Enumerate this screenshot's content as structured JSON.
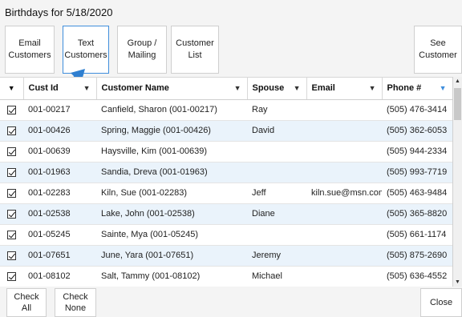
{
  "header": {
    "title": "Birthdays for 5/18/2020"
  },
  "toolbar": {
    "email": "Email\nCustomers",
    "text": "Text\nCustomers",
    "group": "Group /\nMailing",
    "list": "Customer\nList",
    "see": "See\nCustomer"
  },
  "grid": {
    "columns": [
      "Cust Id",
      "Customer Name",
      "Spouse",
      "Email",
      "Phone #"
    ],
    "rows": [
      {
        "id": "001-00217",
        "name": "Canfield, Sharon (001-00217)",
        "spouse": "Ray",
        "email": "",
        "phone": "(505) 476-3414"
      },
      {
        "id": "001-00426",
        "name": "Spring, Maggie (001-00426)",
        "spouse": "David",
        "email": "",
        "phone": "(505) 362-6053"
      },
      {
        "id": "001-00639",
        "name": "Haysville, Kim (001-00639)",
        "spouse": "",
        "email": "",
        "phone": "(505) 944-2334"
      },
      {
        "id": "001-01963",
        "name": "Sandia, Dreva (001-01963)",
        "spouse": "",
        "email": "",
        "phone": "(505) 993-7719"
      },
      {
        "id": "001-02283",
        "name": "Kiln, Sue (001-02283)",
        "spouse": "Jeff",
        "email": "kiln.sue@msn.com",
        "phone": "(505) 463-9484"
      },
      {
        "id": "001-02538",
        "name": "Lake, John (001-02538)",
        "spouse": "Diane",
        "email": "",
        "phone": "(505) 365-8820"
      },
      {
        "id": "001-05245",
        "name": "Sainte, Mya (001-05245)",
        "spouse": "",
        "email": "",
        "phone": "(505) 661-1174"
      },
      {
        "id": "001-07651",
        "name": "June, Yara (001-07651)",
        "spouse": "Jeremy",
        "email": "",
        "phone": "(505) 875-2690"
      },
      {
        "id": "001-08102",
        "name": "Salt, Tammy (001-08102)",
        "spouse": "Michael",
        "email": "",
        "phone": "(505) 636-4552"
      }
    ]
  },
  "footer": {
    "check_all": "Check\nAll",
    "check_none": "Check\nNone",
    "close": "Close"
  },
  "colors": {
    "accent": "#3f8edc",
    "row_alt": "#eaf3fb"
  },
  "icons": {
    "filter": "filter-icon",
    "arrow": "arrow-pointer-icon"
  }
}
